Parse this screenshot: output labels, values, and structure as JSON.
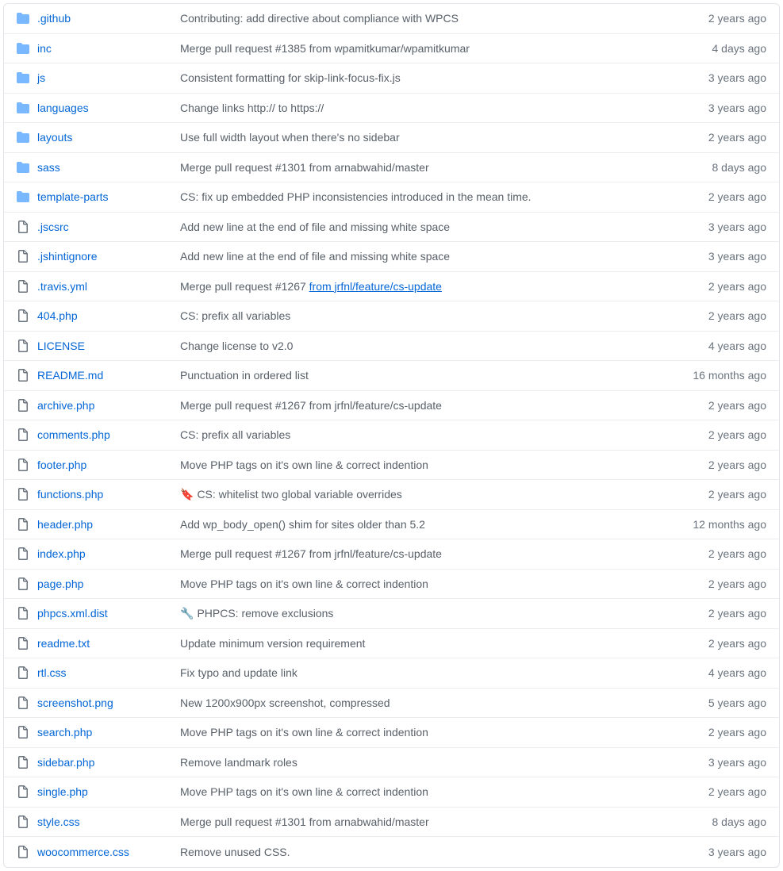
{
  "files": [
    {
      "type": "dir",
      "name": ".github",
      "msg": "Contributing: add directive about compliance with WPCS",
      "age": "2 years ago"
    },
    {
      "type": "dir",
      "name": "inc",
      "msg": "Merge pull request #1385 from wpamitkumar/wpamitkumar",
      "age": "4 days ago"
    },
    {
      "type": "dir",
      "name": "js",
      "msg": "Consistent formatting for skip-link-focus-fix.js",
      "age": "3 years ago"
    },
    {
      "type": "dir",
      "name": "languages",
      "msg": "Change links http:// to https://",
      "age": "3 years ago"
    },
    {
      "type": "dir",
      "name": "layouts",
      "msg": "Use full width layout when there's no sidebar",
      "age": "2 years ago"
    },
    {
      "type": "dir",
      "name": "sass",
      "msg": "Merge pull request #1301 from arnabwahid/master",
      "age": "8 days ago"
    },
    {
      "type": "dir",
      "name": "template-parts",
      "msg": "CS: fix up embedded PHP inconsistencies introduced in the mean time.",
      "age": "2 years ago"
    },
    {
      "type": "file",
      "name": ".jscsrc",
      "msg": "Add new line at the end of file and missing white space",
      "age": "3 years ago"
    },
    {
      "type": "file",
      "name": ".jshintignore",
      "msg": "Add new line at the end of file and missing white space",
      "age": "3 years ago"
    },
    {
      "type": "file",
      "name": ".travis.yml",
      "msg": "Merge pull request #1267 ",
      "link_suffix": "from jrfnl/feature/cs-update",
      "age": "2 years ago"
    },
    {
      "type": "file",
      "name": "404.php",
      "msg": "CS: prefix all variables",
      "age": "2 years ago"
    },
    {
      "type": "file",
      "name": "LICENSE",
      "msg": "Change license to v2.0",
      "age": "4 years ago"
    },
    {
      "type": "file",
      "name": "README.md",
      "msg": "Punctuation in ordered list",
      "age": "16 months ago"
    },
    {
      "type": "file",
      "name": "archive.php",
      "msg": "Merge pull request #1267 from jrfnl/feature/cs-update",
      "age": "2 years ago"
    },
    {
      "type": "file",
      "name": "comments.php",
      "msg": "CS: prefix all variables",
      "age": "2 years ago"
    },
    {
      "type": "file",
      "name": "footer.php",
      "msg": "Move PHP tags on it's own line & correct indention",
      "age": "2 years ago"
    },
    {
      "type": "file",
      "name": "functions.php",
      "emoji": "🔖",
      "msg": "CS: whitelist two global variable overrides",
      "age": "2 years ago"
    },
    {
      "type": "file",
      "name": "header.php",
      "msg": "Add wp_body_open() shim for sites older than 5.2",
      "age": "12 months ago"
    },
    {
      "type": "file",
      "name": "index.php",
      "msg": "Merge pull request #1267 from jrfnl/feature/cs-update",
      "age": "2 years ago"
    },
    {
      "type": "file",
      "name": "page.php",
      "msg": "Move PHP tags on it's own line & correct indention",
      "age": "2 years ago"
    },
    {
      "type": "file",
      "name": "phpcs.xml.dist",
      "emoji": "🔧",
      "msg": "PHPCS: remove exclusions",
      "age": "2 years ago"
    },
    {
      "type": "file",
      "name": "readme.txt",
      "msg": "Update minimum version requirement",
      "age": "2 years ago"
    },
    {
      "type": "file",
      "name": "rtl.css",
      "msg": "Fix typo and update link",
      "age": "4 years ago"
    },
    {
      "type": "file",
      "name": "screenshot.png",
      "msg": "New 1200x900px screenshot, compressed",
      "age": "5 years ago"
    },
    {
      "type": "file",
      "name": "search.php",
      "msg": "Move PHP tags on it's own line & correct indention",
      "age": "2 years ago"
    },
    {
      "type": "file",
      "name": "sidebar.php",
      "msg": "Remove landmark roles",
      "age": "3 years ago"
    },
    {
      "type": "file",
      "name": "single.php",
      "msg": "Move PHP tags on it's own line & correct indention",
      "age": "2 years ago"
    },
    {
      "type": "file",
      "name": "style.css",
      "msg": "Merge pull request #1301 from arnabwahid/master",
      "age": "8 days ago"
    },
    {
      "type": "file",
      "name": "woocommerce.css",
      "msg": "Remove unused CSS.",
      "age": "3 years ago"
    }
  ]
}
